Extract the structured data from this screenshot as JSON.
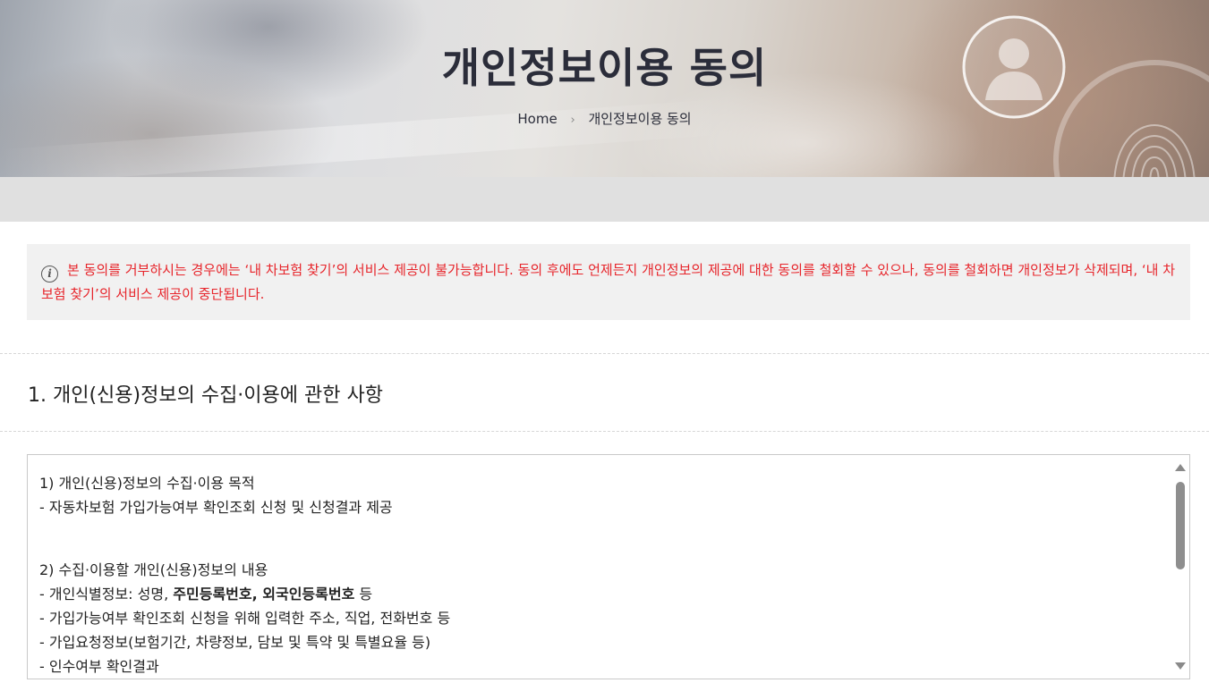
{
  "hero": {
    "title": "개인정보이용 동의",
    "breadcrumb": {
      "home": "Home",
      "separator": "›",
      "current": "개인정보이용 동의"
    }
  },
  "notice": {
    "icon": "info-icon",
    "text": "본 동의를 거부하시는 경우에는 ‘내 차보험 찾기’의 서비스 제공이 불가능합니다. 동의 후에도 언제든지 개인정보의 제공에 대한 동의를 철회할 수 있으나, 동의를 철회하면 개인정보가 삭제되며, ‘내 차보험 찾기’의 서비스 제공이 중단됩니다.",
    "color": "#e7252b"
  },
  "section": {
    "title": "1. 개인(신용)정보의 수집·이용에 관한 사항"
  },
  "terms": {
    "purpose_heading": "1) 개인(신용)정보의 수집·이용 목적",
    "purpose_item": " - 자동차보험 가입가능여부 확인조회 신청 및 신청결과 제공",
    "content_heading": "2) 수집·이용할 개인(신용)정보의 내용",
    "item1_prefix": " - 개인식별정보: 성명, ",
    "item1_bold": "주민등록번호, 외국인등록번호",
    "item1_suffix": " 등",
    "item2": " - 가입가능여부 확인조회 신청을 위해 입력한 주소, 직업, 전화번호 등",
    "item3": " - 가입요청정보(보험기간, 차량정보, 담보 및 특약 및 특별요율 등)",
    "item4": " - 인수여부 확인결과"
  }
}
